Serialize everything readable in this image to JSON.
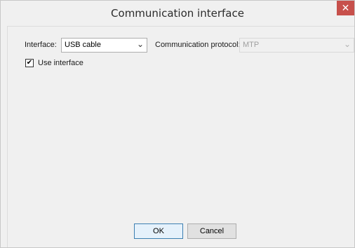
{
  "window": {
    "title": "Communication interface",
    "close_glyph": "✕"
  },
  "interface": {
    "label": "Interface:",
    "value": "USB cable",
    "chevron": "⌄"
  },
  "protocol": {
    "label": "Communication protocol:",
    "value": "MTP",
    "chevron": "⌄",
    "disabled": true
  },
  "use_interface": {
    "label": "Use interface",
    "checked": true,
    "check_glyph": "✔"
  },
  "buttons": {
    "ok": "OK",
    "cancel": "Cancel"
  },
  "colors": {
    "close_button": "#c7504b",
    "default_button_border": "#3c7fb1"
  }
}
